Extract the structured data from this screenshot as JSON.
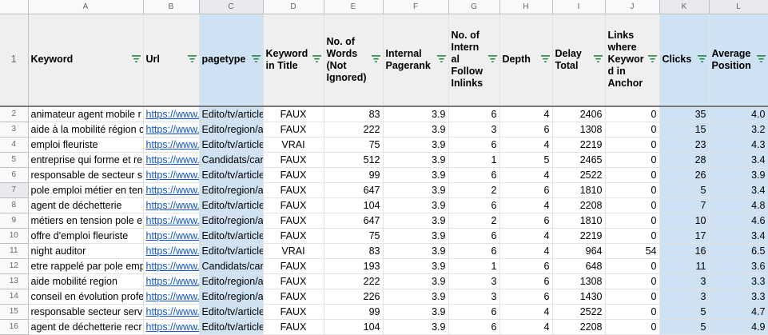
{
  "columns": [
    "",
    "A",
    "B",
    "C",
    "D",
    "E",
    "F",
    "G",
    "H",
    "I",
    "J",
    "K",
    "L"
  ],
  "header_row_number": "1",
  "headers": [
    "Keyword",
    "Url",
    "pagetype",
    "Keyword in Title",
    "No. of Words (Not Ignored)",
    "Internal Pagerank",
    "No. of Intern al Follow Inlinks",
    "Depth",
    "Delay Total",
    "Links where Keywor d in Anchor",
    "Clicks",
    "Average Position"
  ],
  "rows": [
    {
      "n": "2",
      "keyword": "animateur agent mobile r",
      "url": "https://www.",
      "pagetype": "Edito/tv/article",
      "title": "FAUX",
      "words": "83",
      "pagerank": "3.9",
      "inlinks": "6",
      "depth": "4",
      "delay": "2406",
      "anchor": "0",
      "clicks": "35",
      "position": "4.0"
    },
    {
      "n": "3",
      "keyword": "aide à la mobilité région c",
      "url": "https://www.",
      "pagetype": "Edito/region/a",
      "title": "FAUX",
      "words": "222",
      "pagerank": "3.9",
      "inlinks": "3",
      "depth": "6",
      "delay": "1308",
      "anchor": "0",
      "clicks": "15",
      "position": "3.2"
    },
    {
      "n": "4",
      "keyword": "emploi fleuriste",
      "url": "https://www.",
      "pagetype": "Edito/tv/article",
      "title": "VRAI",
      "words": "75",
      "pagerank": "3.9",
      "inlinks": "6",
      "depth": "4",
      "delay": "2219",
      "anchor": "0",
      "clicks": "23",
      "position": "4.3"
    },
    {
      "n": "5",
      "keyword": "entreprise qui forme et re",
      "url": "https://www.",
      "pagetype": "Candidats/car",
      "title": "FAUX",
      "words": "512",
      "pagerank": "3.9",
      "inlinks": "1",
      "depth": "5",
      "delay": "2465",
      "anchor": "0",
      "clicks": "28",
      "position": "3.4"
    },
    {
      "n": "6",
      "keyword": "responsable de secteur s",
      "url": "https://www.",
      "pagetype": "Edito/tv/article",
      "title": "FAUX",
      "words": "99",
      "pagerank": "3.9",
      "inlinks": "6",
      "depth": "4",
      "delay": "2522",
      "anchor": "0",
      "clicks": "26",
      "position": "3.9"
    },
    {
      "n": "7",
      "keyword": "pole emploi métier en ten",
      "url": "https://www.",
      "pagetype": "Edito/region/a",
      "title": "FAUX",
      "words": "647",
      "pagerank": "3.9",
      "inlinks": "2",
      "depth": "6",
      "delay": "1810",
      "anchor": "0",
      "clicks": "5",
      "position": "3.4"
    },
    {
      "n": "8",
      "keyword": "agent de déchetterie",
      "url": "https://www.",
      "pagetype": "Edito/tv/article",
      "title": "FAUX",
      "words": "104",
      "pagerank": "3.9",
      "inlinks": "6",
      "depth": "4",
      "delay": "2208",
      "anchor": "0",
      "clicks": "7",
      "position": "4.8"
    },
    {
      "n": "9",
      "keyword": "métiers en tension pole e",
      "url": "https://www.",
      "pagetype": "Edito/region/a",
      "title": "FAUX",
      "words": "647",
      "pagerank": "3.9",
      "inlinks": "2",
      "depth": "6",
      "delay": "1810",
      "anchor": "0",
      "clicks": "10",
      "position": "4.6"
    },
    {
      "n": "10",
      "keyword": "offre d'emploi fleuriste",
      "url": "https://www.",
      "pagetype": "Edito/tv/article",
      "title": "FAUX",
      "words": "75",
      "pagerank": "3.9",
      "inlinks": "6",
      "depth": "4",
      "delay": "2219",
      "anchor": "0",
      "clicks": "17",
      "position": "3.4"
    },
    {
      "n": "11",
      "keyword": "night auditor",
      "url": "https://www.",
      "pagetype": "Edito/tv/article",
      "title": "VRAI",
      "words": "83",
      "pagerank": "3.9",
      "inlinks": "6",
      "depth": "4",
      "delay": "964",
      "anchor": "54",
      "clicks": "16",
      "position": "6.5"
    },
    {
      "n": "12",
      "keyword": "etre rappelé par pole emp",
      "url": "https://www.",
      "pagetype": "Candidats/car",
      "title": "FAUX",
      "words": "193",
      "pagerank": "3.9",
      "inlinks": "1",
      "depth": "6",
      "delay": "648",
      "anchor": "0",
      "clicks": "11",
      "position": "3.6"
    },
    {
      "n": "13",
      "keyword": "aide mobilité region",
      "url": "https://www.",
      "pagetype": "Edito/region/a",
      "title": "FAUX",
      "words": "222",
      "pagerank": "3.9",
      "inlinks": "3",
      "depth": "6",
      "delay": "1308",
      "anchor": "0",
      "clicks": "3",
      "position": "3.3"
    },
    {
      "n": "14",
      "keyword": "conseil en évolution profe",
      "url": "https://www.",
      "pagetype": "Edito/region/a",
      "title": "FAUX",
      "words": "226",
      "pagerank": "3.9",
      "inlinks": "3",
      "depth": "6",
      "delay": "1430",
      "anchor": "0",
      "clicks": "3",
      "position": "3.3"
    },
    {
      "n": "15",
      "keyword": "responsable secteur serv",
      "url": "https://www.",
      "pagetype": "Edito/tv/article",
      "title": "FAUX",
      "words": "99",
      "pagerank": "3.9",
      "inlinks": "6",
      "depth": "4",
      "delay": "2522",
      "anchor": "0",
      "clicks": "5",
      "position": "4.7"
    },
    {
      "n": "16",
      "keyword": "agent de déchetterie recr",
      "url": "https://www.",
      "pagetype": "Edito/tv/article",
      "title": "FAUX",
      "words": "104",
      "pagerank": "3.9",
      "inlinks": "6",
      "depth": "4",
      "delay": "2208",
      "anchor": "0",
      "clicks": "5",
      "position": "4.9"
    }
  ],
  "colors": {
    "highlight_column": "#cfe2f3",
    "header_bg": "#efefef",
    "filter_icon": "#188038",
    "link": "#1155cc"
  },
  "icons": {
    "filter": "filter-funnel-icon"
  }
}
